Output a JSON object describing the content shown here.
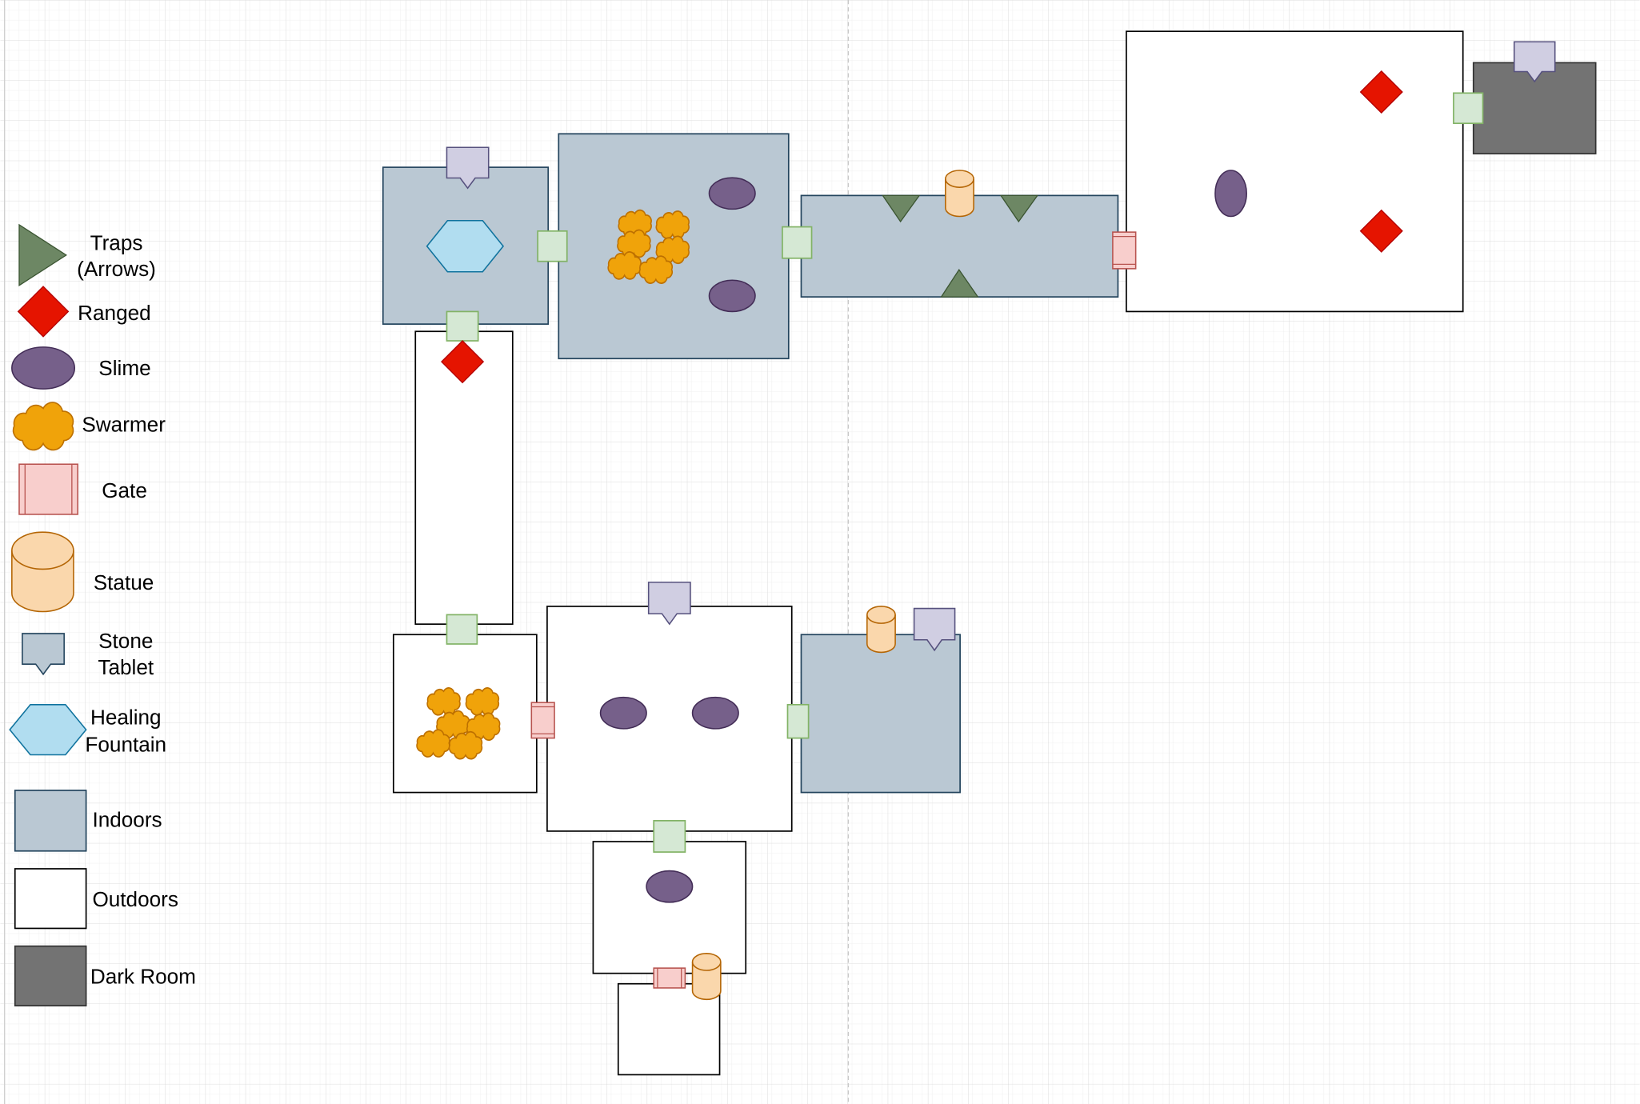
{
  "legend": {
    "traps": [
      "Traps",
      "(Arrows)"
    ],
    "ranged": "Ranged",
    "slime": "Slime",
    "swarmer": "Swarmer",
    "gate": "Gate",
    "statue": "Statue",
    "stone_tablet": [
      "Stone",
      "Tablet"
    ],
    "healing_fountain": [
      "Healing",
      "Fountain"
    ],
    "indoors": "Indoors",
    "outdoors": "Outdoors",
    "dark_room": "Dark Room"
  },
  "colors": {
    "trap": "#6d8764",
    "ranged": "#e51400",
    "slime": "#76608a",
    "swarmer": "#f0a30a",
    "gate": "#f8cecc",
    "statue": "#fad7ac",
    "stone_tablet": "#d0cee2",
    "healing_fountain": "#b1ddf0",
    "indoors": "#bac8d3",
    "outdoors": "#ffffff",
    "dark_room": "#737373",
    "door": "#d5e8d4"
  },
  "rooms": [
    {
      "type": "indoors",
      "contents": [
        "stone_tablet",
        "healing_fountain"
      ]
    },
    {
      "type": "indoors",
      "contents": [
        "swarmer x6",
        "slime x2"
      ]
    },
    {
      "type": "indoors",
      "contents": [
        "trap x3",
        "statue"
      ]
    },
    {
      "type": "outdoors",
      "contents": [
        "slime",
        "ranged x2"
      ]
    },
    {
      "type": "dark_room",
      "contents": [
        "stone_tablet"
      ]
    },
    {
      "type": "outdoors",
      "contents": [
        "ranged"
      ]
    },
    {
      "type": "outdoors",
      "contents": [
        "swarmer x6"
      ]
    },
    {
      "type": "outdoors",
      "contents": [
        "stone_tablet",
        "slime x2"
      ]
    },
    {
      "type": "indoors",
      "contents": [
        "statue",
        "stone_tablet"
      ]
    },
    {
      "type": "outdoors",
      "contents": [
        "slime",
        "statue"
      ]
    },
    {
      "type": "outdoors",
      "contents": []
    }
  ]
}
